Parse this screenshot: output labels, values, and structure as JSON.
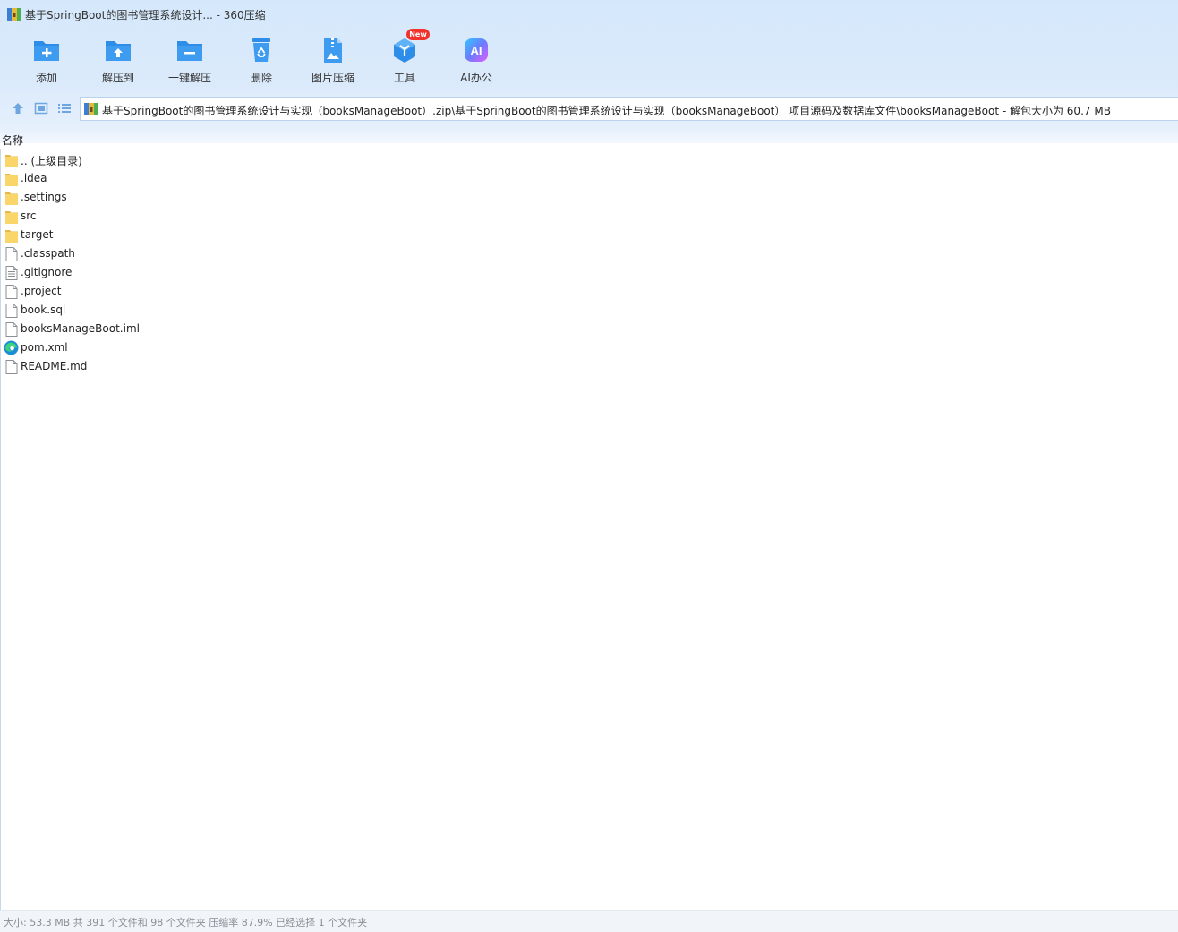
{
  "window": {
    "title": "基于SpringBoot的图书管理系统设计... - 360压缩",
    "app_icon": "archive-app-icon"
  },
  "toolbar": {
    "items": [
      {
        "label": "添加",
        "icon": "folder-add-icon"
      },
      {
        "label": "解压到",
        "icon": "folder-extract-icon"
      },
      {
        "label": "一键解压",
        "icon": "folder-one-click-extract-icon"
      },
      {
        "label": "删除",
        "icon": "recycle-bin-icon"
      },
      {
        "label": "图片压缩",
        "icon": "image-compress-icon"
      },
      {
        "label": "工具",
        "icon": "tools-cube-icon"
      },
      {
        "label": "AI办公",
        "icon": "ai-office-icon"
      }
    ],
    "badge": "New",
    "ai_glyph": "AI"
  },
  "nav": {
    "path": "基于SpringBoot的图书管理系统设计与实现（booksManageBoot）.zip\\基于SpringBoot的图书管理系统设计与实现（booksManageBoot） 项目源码及数据库文件\\booksManageBoot - 解包大小为 60.7 MB"
  },
  "list": {
    "column_name": "名称",
    "files": [
      {
        "name": ".. (上级目录)",
        "type": "folder"
      },
      {
        "name": ".idea",
        "type": "folder"
      },
      {
        "name": ".settings",
        "type": "folder"
      },
      {
        "name": "src",
        "type": "folder"
      },
      {
        "name": "target",
        "type": "folder"
      },
      {
        "name": ".classpath",
        "type": "file"
      },
      {
        "name": ".gitignore",
        "type": "text"
      },
      {
        "name": ".project",
        "type": "file"
      },
      {
        "name": "book.sql",
        "type": "file"
      },
      {
        "name": "booksManageBoot.iml",
        "type": "file"
      },
      {
        "name": "pom.xml",
        "type": "edge"
      },
      {
        "name": "README.md",
        "type": "file"
      }
    ]
  },
  "status": {
    "text": "大小: 53.3 MB 共 391 个文件和 98 个文件夹 压缩率 87.9% 已经选择 1 个文件夹"
  },
  "colors": {
    "accent": "#2e8de8",
    "folder": "#f7cf5a",
    "badge": "#f2332d"
  }
}
